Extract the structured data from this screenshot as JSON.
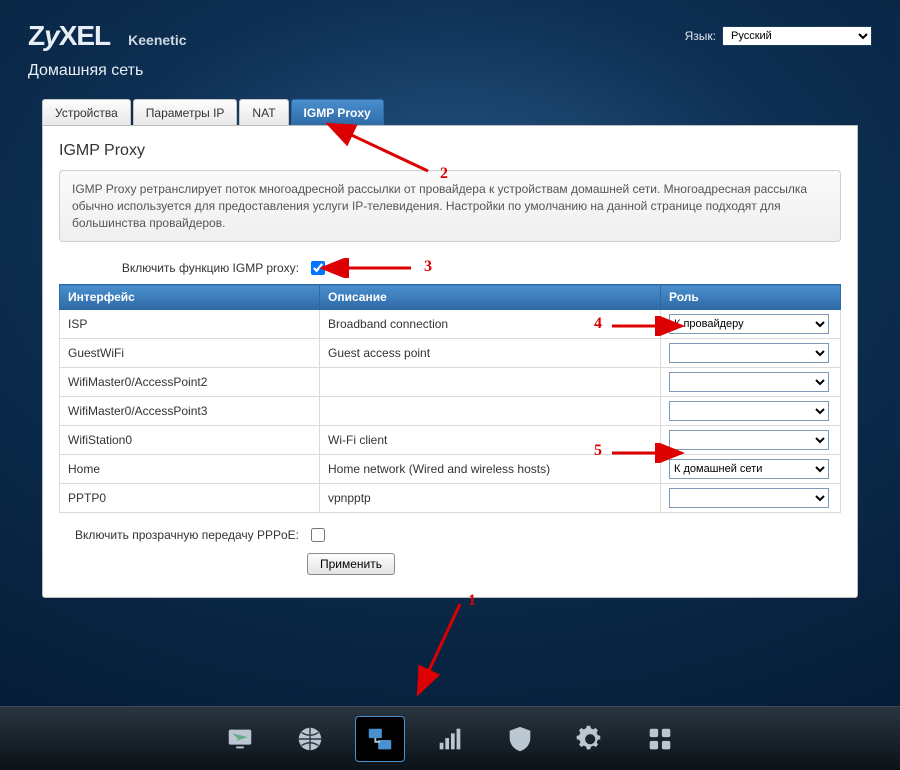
{
  "header": {
    "brand": "ZyXEL",
    "model": "Keenetic",
    "language_label": "Язык:",
    "language_value": "Русский",
    "page_title": "Домашняя сеть"
  },
  "tabs": [
    {
      "label": "Устройства"
    },
    {
      "label": "Параметры IP"
    },
    {
      "label": "NAT"
    },
    {
      "label": "IGMP Proxy"
    }
  ],
  "active_tab_index": 3,
  "panel": {
    "heading": "IGMP Proxy",
    "info": "IGMP Proxy ретранслирует поток многоадресной рассылки от провайдера к устройствам домашней сети. Многоадресная рассылка обычно используется для предоставления услуги IP-телевидения. Настройки по умолчанию на данной странице подходят для большинства провайдеров.",
    "enable_label": "Включить функцию IGMP proxy:",
    "enable_checked": true,
    "columns": {
      "iface": "Интерфейс",
      "desc": "Описание",
      "role": "Роль"
    },
    "role_options": [
      "",
      "К провайдеру",
      "К домашней сети"
    ],
    "rows": [
      {
        "iface": "ISP",
        "desc": "Broadband connection",
        "role": "К провайдеру"
      },
      {
        "iface": "GuestWiFi",
        "desc": "Guest access point",
        "role": ""
      },
      {
        "iface": "WifiMaster0/AccessPoint2",
        "desc": "",
        "role": ""
      },
      {
        "iface": "WifiMaster0/AccessPoint3",
        "desc": "",
        "role": ""
      },
      {
        "iface": "WifiStation0",
        "desc": "Wi-Fi client",
        "role": ""
      },
      {
        "iface": "Home",
        "desc": "Home network (Wired and wireless hosts)",
        "role": "К домашней сети"
      },
      {
        "iface": "PPTP0",
        "desc": "vpnpptp",
        "role": ""
      }
    ],
    "pppoe_label": "Включить прозрачную передачу PPPoE:",
    "pppoe_checked": false,
    "apply_label": "Применить"
  },
  "dock": {
    "items": [
      {
        "name": "monitor-icon"
      },
      {
        "name": "globe-icon"
      },
      {
        "name": "network-icon"
      },
      {
        "name": "wifi-icon"
      },
      {
        "name": "shield-icon"
      },
      {
        "name": "gear-icon"
      },
      {
        "name": "apps-icon"
      }
    ],
    "active_index": 2
  },
  "annotations": {
    "n1": "1",
    "n2": "2",
    "n3": "3",
    "n4": "4",
    "n5": "5"
  }
}
